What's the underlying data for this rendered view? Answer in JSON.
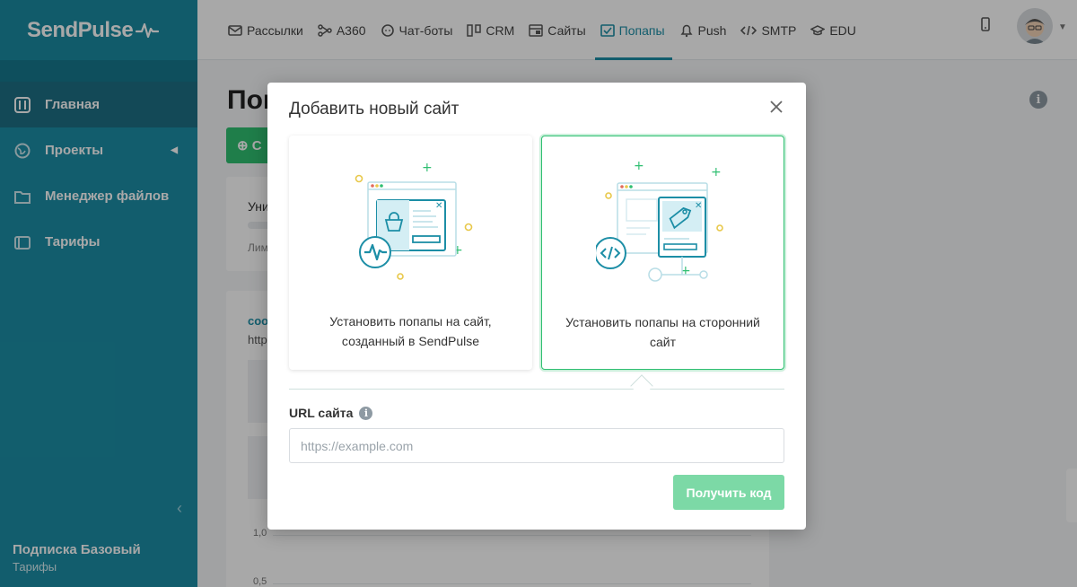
{
  "brand": {
    "logo_text": "SendPulse"
  },
  "sidebar": {
    "items": [
      {
        "label": "Главная",
        "icon": "sliders-icon"
      },
      {
        "label": "Проекты",
        "icon": "globe-icon"
      },
      {
        "label": "Менеджер файлов",
        "icon": "folder-icon"
      },
      {
        "label": "Тарифы",
        "icon": "wallet-icon"
      }
    ],
    "plan_name": "Подписка Базовый",
    "plan_link": "Тарифы"
  },
  "topnav": {
    "items": [
      {
        "label": "Рассылки",
        "icon": "mail-icon"
      },
      {
        "label": "A360",
        "icon": "flow-icon"
      },
      {
        "label": "Чат-боты",
        "icon": "chat-icon"
      },
      {
        "label": "CRM",
        "icon": "crm-icon"
      },
      {
        "label": "Сайты",
        "icon": "site-icon"
      },
      {
        "label": "Попапы",
        "icon": "popup-icon",
        "active": true
      },
      {
        "label": "Push",
        "icon": "bell-icon"
      },
      {
        "label": "SMTP",
        "icon": "code-icon"
      },
      {
        "label": "EDU",
        "icon": "graduation-icon"
      }
    ],
    "accent_color": "#1c8ea6"
  },
  "page": {
    "title_partial": "Поп",
    "create_button_partial": "С",
    "card1_text": "Уни",
    "card1_sub": "Лим",
    "card2_link": "соо",
    "card2_url": "http",
    "axis_tick_1": "1,0",
    "axis_tick_2": "0,5"
  },
  "modal": {
    "title": "Добавить новый сайт",
    "option_sendpulse_label": "Установить попапы на сайт, созданный в SendPulse",
    "option_external_label": "Установить попапы на сторонний сайт",
    "selected_option": "external",
    "url_label": "URL сайта",
    "url_placeholder": "https://example.com",
    "url_value": "",
    "submit_label": "Получить код",
    "colors": {
      "selected_border": "#2fbf71",
      "submit_bg": "#7cd9a6",
      "illustration": "#1c8ea6"
    }
  }
}
